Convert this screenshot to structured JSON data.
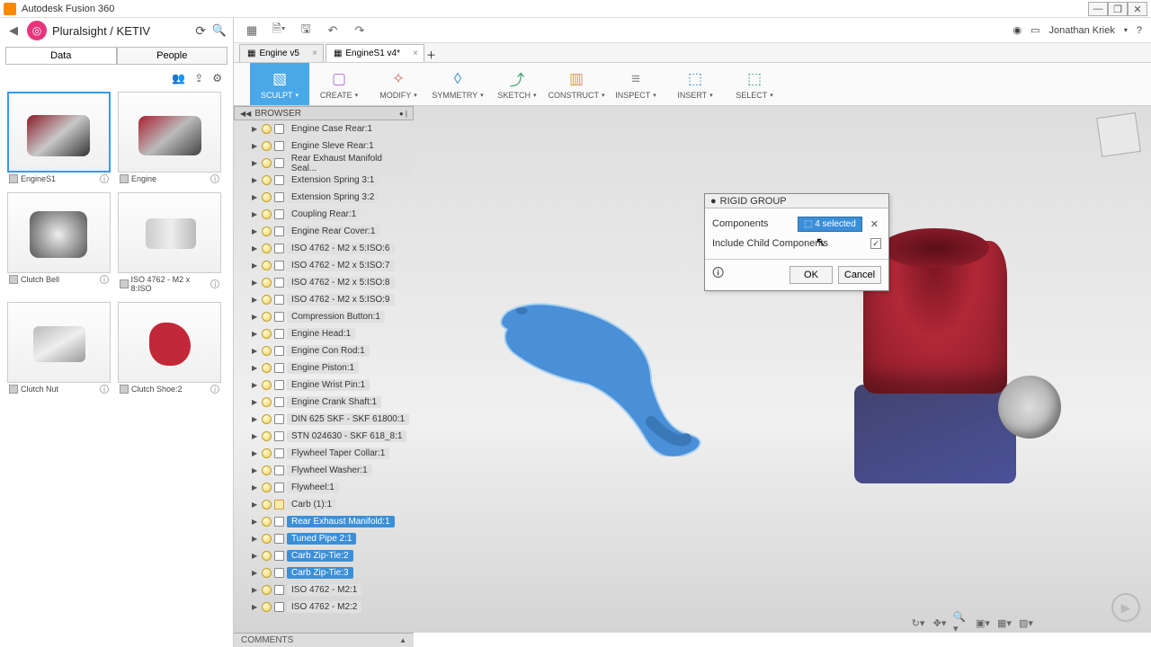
{
  "app": {
    "title": "Autodesk Fusion 360"
  },
  "leftpanel": {
    "path": "Pluralsight / KETIV",
    "tabs": {
      "data": "Data",
      "people": "People"
    },
    "thumbs": [
      {
        "label": "EngineS1"
      },
      {
        "label": "Engine"
      },
      {
        "label": "Clutch Bell"
      },
      {
        "label": "ISO 4762 - M2 x 8:ISO"
      },
      {
        "label": "Clutch Nut"
      },
      {
        "label": "Clutch Shoe:2"
      }
    ]
  },
  "quickbar": {
    "username": "Jonathan Kriek"
  },
  "filetabs": [
    {
      "label": "Engine v5",
      "active": false
    },
    {
      "label": "EngineS1 v4*",
      "active": true
    }
  ],
  "ribbon": [
    {
      "label": "SCULPT"
    },
    {
      "label": "CREATE"
    },
    {
      "label": "MODIFY"
    },
    {
      "label": "SYMMETRY"
    },
    {
      "label": "SKETCH"
    },
    {
      "label": "CONSTRUCT"
    },
    {
      "label": "INSPECT"
    },
    {
      "label": "INSERT"
    },
    {
      "label": "SELECT"
    }
  ],
  "browser": {
    "title": "BROWSER",
    "items": [
      {
        "label": "Engine Case Rear:1",
        "sel": false
      },
      {
        "label": "Engine Sleve Rear:1",
        "sel": false
      },
      {
        "label": "Rear Exhaust Manifold Seal...",
        "sel": false
      },
      {
        "label": "Extension Spring 3:1",
        "sel": false
      },
      {
        "label": "Extension Spring 3:2",
        "sel": false
      },
      {
        "label": "Coupling Rear:1",
        "sel": false
      },
      {
        "label": "Engine Rear Cover:1",
        "sel": false
      },
      {
        "label": "ISO 4762 - M2 x 5:ISO:6",
        "sel": false
      },
      {
        "label": "ISO 4762 - M2 x 5:ISO:7",
        "sel": false
      },
      {
        "label": "ISO 4762 - M2 x 5:ISO:8",
        "sel": false
      },
      {
        "label": "ISO 4762 - M2 x 5:ISO:9",
        "sel": false
      },
      {
        "label": "Compression Button:1",
        "sel": false
      },
      {
        "label": "Engine Head:1",
        "sel": false
      },
      {
        "label": "Engine Con Rod:1",
        "sel": false
      },
      {
        "label": "Engine Piston:1",
        "sel": false
      },
      {
        "label": "Engine Wrist Pin:1",
        "sel": false
      },
      {
        "label": "Engine Crank Shaft:1",
        "sel": false
      },
      {
        "label": "DIN 625 SKF - SKF 61800:1",
        "sel": false
      },
      {
        "label": "STN 024630 - SKF 618_8:1",
        "sel": false
      },
      {
        "label": "Flywheel Taper Collar:1",
        "sel": false
      },
      {
        "label": "Flywheel Washer:1",
        "sel": false
      },
      {
        "label": "Flywheel:1",
        "sel": false
      },
      {
        "label": "Carb (1):1",
        "sel": false,
        "carb": true
      },
      {
        "label": "Rear Exhaust Manifold:1",
        "sel": true
      },
      {
        "label": "Tuned Pipe 2:1",
        "sel": true
      },
      {
        "label": "Carb Zip-Tie:2",
        "sel": true
      },
      {
        "label": "Carb Zip-Tie:3",
        "sel": true
      },
      {
        "label": "ISO 4762 - M2:1",
        "sel": false
      },
      {
        "label": "ISO 4762 - M2:2",
        "sel": false
      }
    ]
  },
  "dialog": {
    "title": "RIGID GROUP",
    "rows": {
      "components": "Components",
      "include": "Include Child Components"
    },
    "selchip": "4 selected",
    "ok": "OK",
    "cancel": "Cancel"
  },
  "comments": {
    "label": "COMMENTS"
  }
}
